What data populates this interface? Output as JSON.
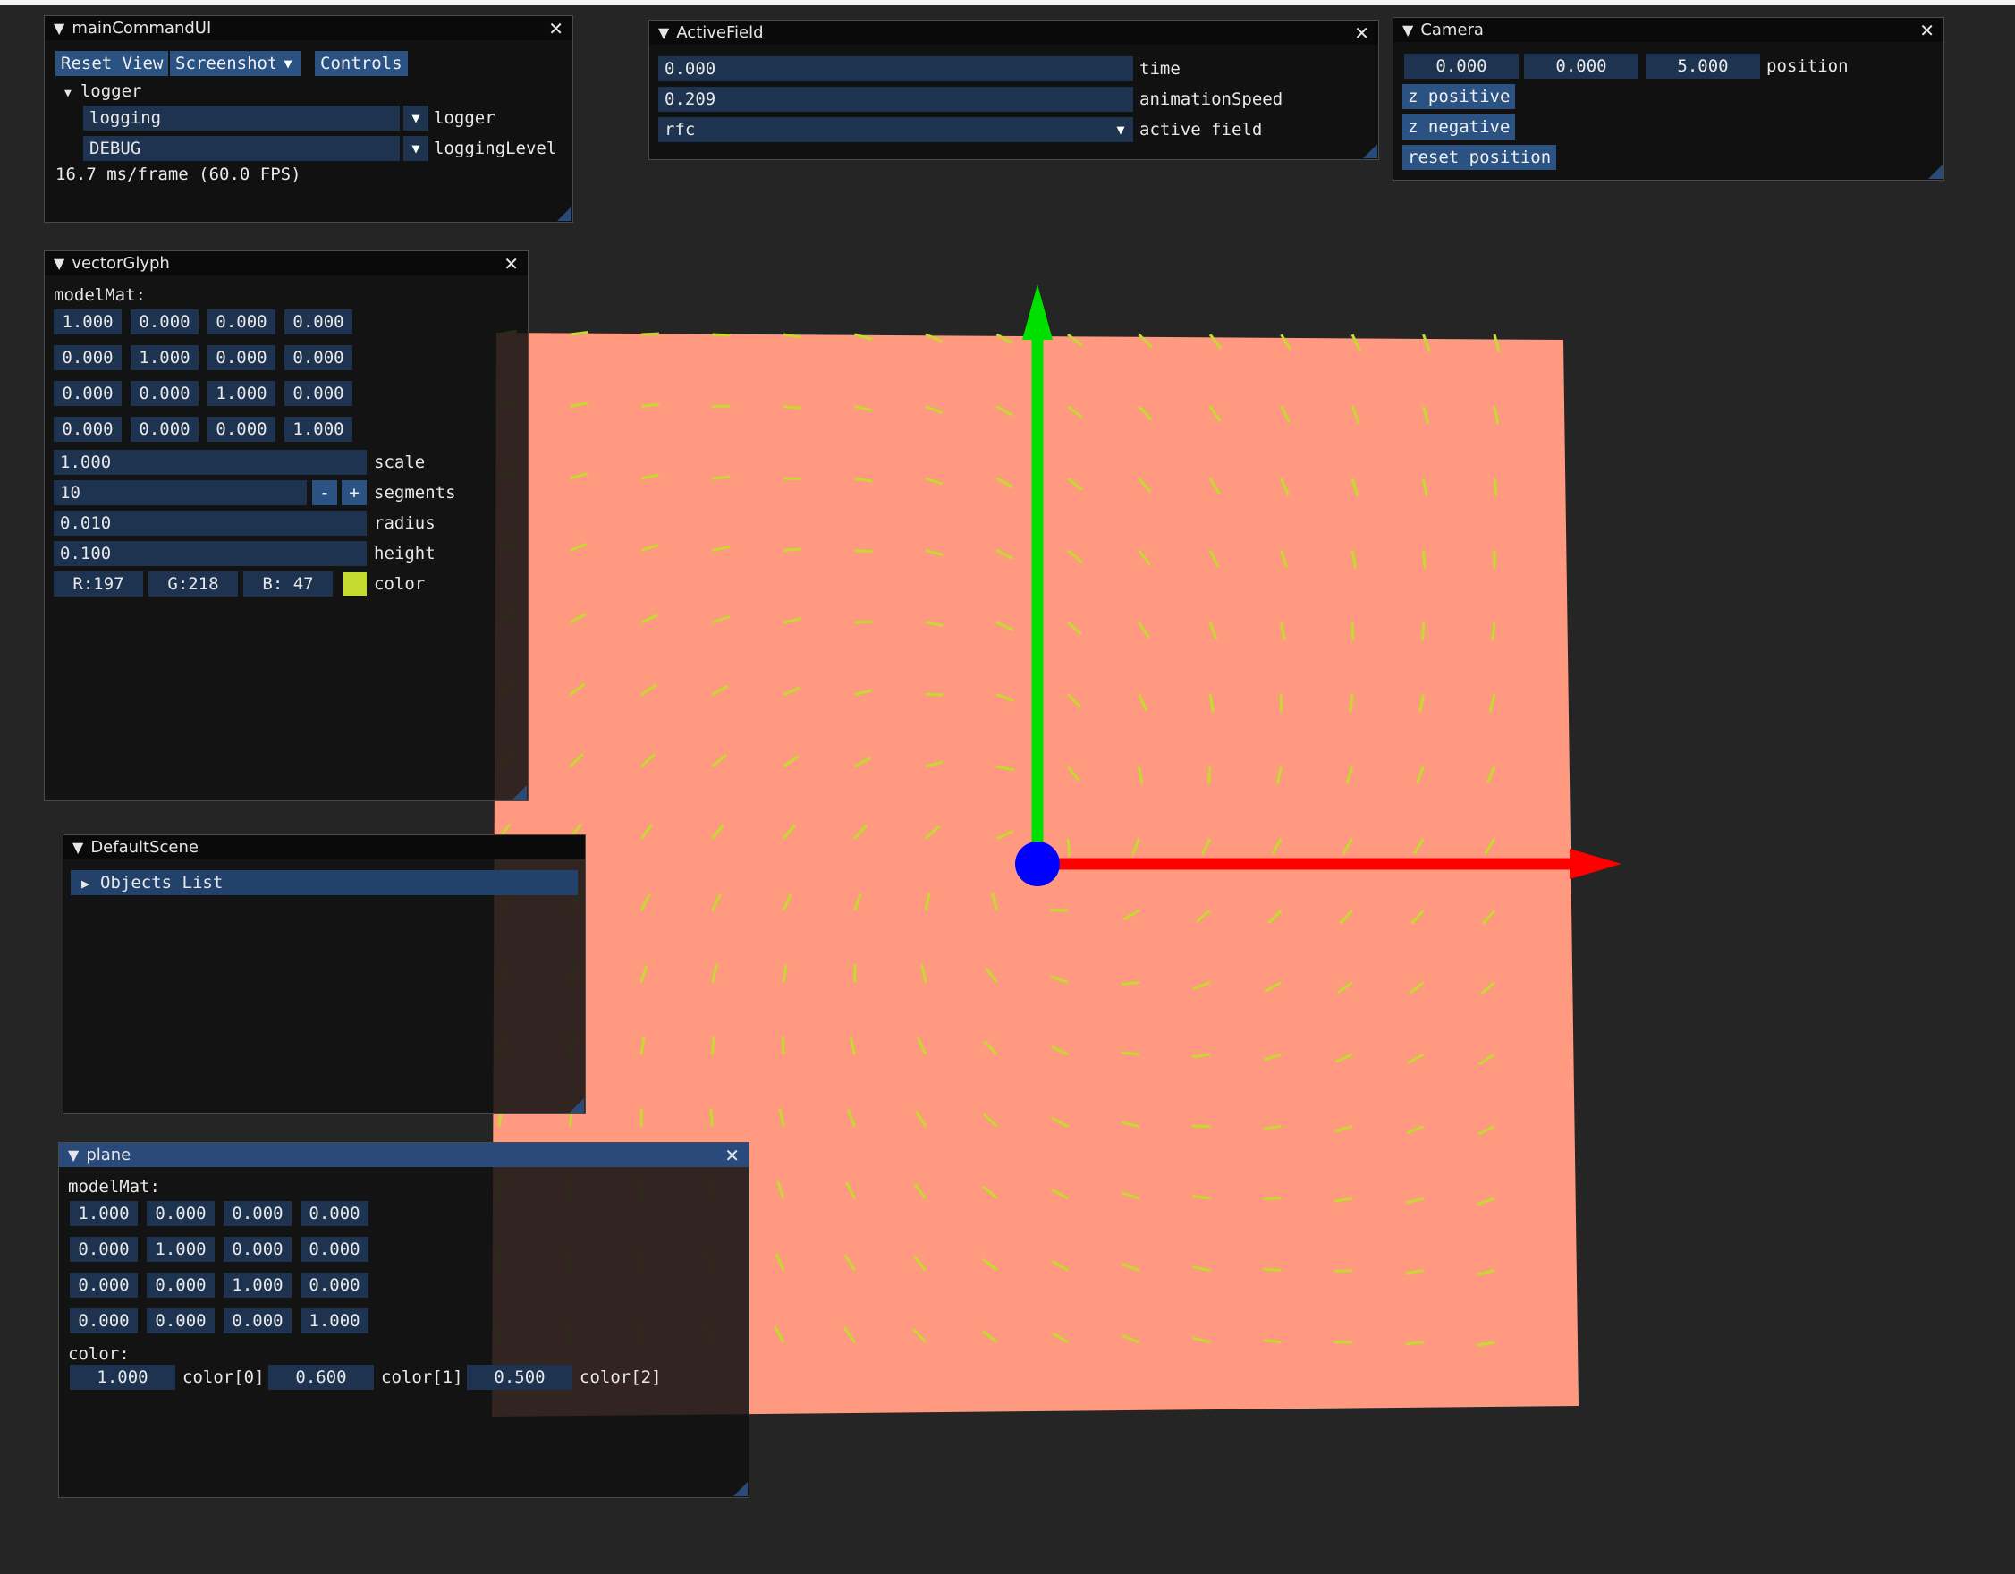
{
  "mainCommandUI": {
    "title": "mainCommandUI",
    "reset_view": "Reset View",
    "screenshot": "Screenshot",
    "controls": "Controls",
    "logger_node": "logger",
    "logger_value": "logging",
    "logger_label": "logger",
    "logging_level_value": "DEBUG",
    "logging_level_label": "loggingLevel",
    "fps": "16.7 ms/frame (60.0 FPS)"
  },
  "activeField": {
    "title": "ActiveField",
    "time_value": "0.000",
    "time_label": "time",
    "speed_value": "0.209",
    "speed_label": "animationSpeed",
    "field_value": "rfc",
    "field_label": "active field"
  },
  "camera": {
    "title": "Camera",
    "pos_x": "0.000",
    "pos_y": "0.000",
    "pos_z": "5.000",
    "position_label": "position",
    "z_positive": "z positive",
    "z_negative": "z negative",
    "reset_position": "reset position"
  },
  "vectorGlyph": {
    "title": "vectorGlyph",
    "model_mat_label": "modelMat:",
    "matrix": [
      [
        "1.000",
        "0.000",
        "0.000",
        "0.000"
      ],
      [
        "0.000",
        "1.000",
        "0.000",
        "0.000"
      ],
      [
        "0.000",
        "0.000",
        "1.000",
        "0.000"
      ],
      [
        "0.000",
        "0.000",
        "0.000",
        "1.000"
      ]
    ],
    "scale_value": "1.000",
    "scale_label": "scale",
    "segments_value": "10",
    "segments_label": "segments",
    "minus": "-",
    "plus": "+",
    "radius_value": "0.010",
    "radius_label": "radius",
    "height_value": "0.100",
    "height_label": "height",
    "r": "R:197",
    "g": "G:218",
    "b": "B: 47",
    "color_label": "color",
    "swatch_color": "#c5da2f"
  },
  "defaultScene": {
    "title": "DefaultScene",
    "objects_list": "Objects List"
  },
  "plane": {
    "title": "plane",
    "model_mat_label": "modelMat:",
    "matrix": [
      [
        "1.000",
        "0.000",
        "0.000",
        "0.000"
      ],
      [
        "0.000",
        "1.000",
        "0.000",
        "0.000"
      ],
      [
        "0.000",
        "0.000",
        "1.000",
        "0.000"
      ],
      [
        "0.000",
        "0.000",
        "0.000",
        "1.000"
      ]
    ],
    "color_label": "color:",
    "c0_value": "1.000",
    "c0_label": "color[0]",
    "c1_value": "0.600",
    "c1_label": "color[1]",
    "c2_value": "0.500",
    "c2_label": "color[2]"
  },
  "scene": {
    "plane_color": "#ff9980",
    "glyph_color": "#c5da2f",
    "x_axis_color": "#ff0000",
    "y_axis_color": "#00e000",
    "origin_color": "#0000ff",
    "ui_accent": "#294a7a"
  }
}
